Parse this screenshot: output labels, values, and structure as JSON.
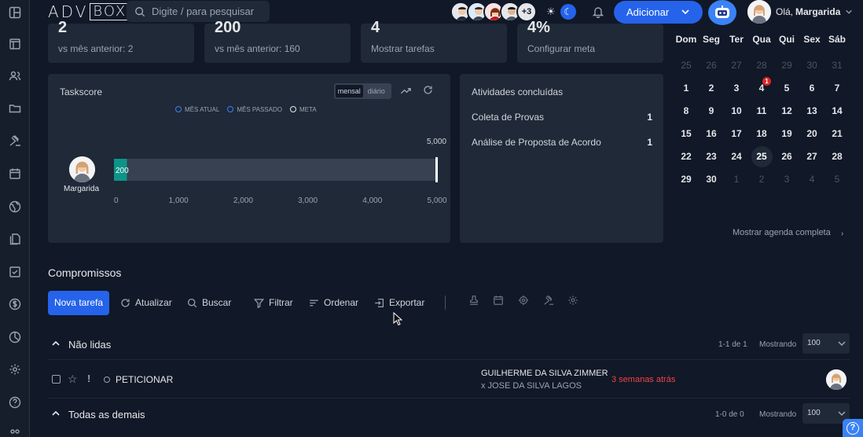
{
  "topbar": {
    "search_placeholder": "Digite / para pesquisar",
    "avatars_more": "+3",
    "add_label": "Adicionar",
    "greeting": "Olá,",
    "user_name": "Margarida"
  },
  "stats": [
    {
      "value": "2",
      "label": "vs mês anterior: 2"
    },
    {
      "value": "200",
      "label": "vs mês anterior: 160"
    },
    {
      "value": "4",
      "label": "Mostrar tarefas"
    },
    {
      "value": "4%",
      "label": "Configurar meta"
    }
  ],
  "calendar": {
    "weekdays": [
      "Dom",
      "Seg",
      "Ter",
      "Qua",
      "Qui",
      "Sex",
      "Sáb"
    ],
    "weeks": [
      [
        "25",
        "26",
        "27",
        "28",
        "29",
        "30",
        "31"
      ],
      [
        "1",
        "2",
        "3",
        "4",
        "5",
        "6",
        "7"
      ],
      [
        "8",
        "9",
        "10",
        "11",
        "12",
        "13",
        "14"
      ],
      [
        "15",
        "16",
        "17",
        "18",
        "19",
        "20",
        "21"
      ],
      [
        "22",
        "23",
        "24",
        "25",
        "26",
        "27",
        "28"
      ],
      [
        "29",
        "30",
        "1",
        "2",
        "3",
        "4",
        "5"
      ]
    ],
    "today": "25",
    "badge_day": "4",
    "badge_count": "1",
    "show_full": "Mostrar agenda completa"
  },
  "taskscore": {
    "title": "Taskscore",
    "seg_mensal": "mensal",
    "seg_diario": "diário",
    "legend": [
      "MÊS ATUAL",
      "MÊS PASSADO",
      "META"
    ],
    "member": "Margarida"
  },
  "chart_data": {
    "type": "bar",
    "orientation": "horizontal",
    "categories": [
      "Margarida"
    ],
    "series": [
      {
        "name": "MÊS ATUAL",
        "values": [
          200
        ],
        "color": "#0d9488"
      },
      {
        "name": "META",
        "values": [
          5000
        ],
        "color": "#ffffff"
      }
    ],
    "data_labels": [
      "200"
    ],
    "goal_label": "5,000",
    "xlim": [
      0,
      5000
    ],
    "xticks": [
      "0",
      "1,000",
      "2,000",
      "3,000",
      "4,000",
      "5,000"
    ]
  },
  "atividades": {
    "title": "Atividades concluídas",
    "items": [
      {
        "label": "Coleta de Provas",
        "value": "1"
      },
      {
        "label": "Análise de Proposta de Acordo",
        "value": "1"
      }
    ]
  },
  "compromissos": {
    "title": "Compromissos",
    "nova": "Nova tarefa",
    "toolbar": [
      "Atualizar",
      "Buscar",
      "Filtrar",
      "Ordenar",
      "Exportar"
    ]
  },
  "groups": [
    {
      "label": "Não lidas",
      "count": "1-1 de 1",
      "showing": "Mostrando",
      "page_size": "100"
    },
    {
      "label": "Todas as demais",
      "count": "1-0 de 0",
      "showing": "Mostrando",
      "page_size": "100"
    }
  ],
  "task": {
    "name": "PETICIONAR",
    "party1": "GUILHERME DA SILVA ZIMMER",
    "party2": "x JOSE DA SILVA LAGOS",
    "when": "3 semanas atrás"
  },
  "help": "?"
}
